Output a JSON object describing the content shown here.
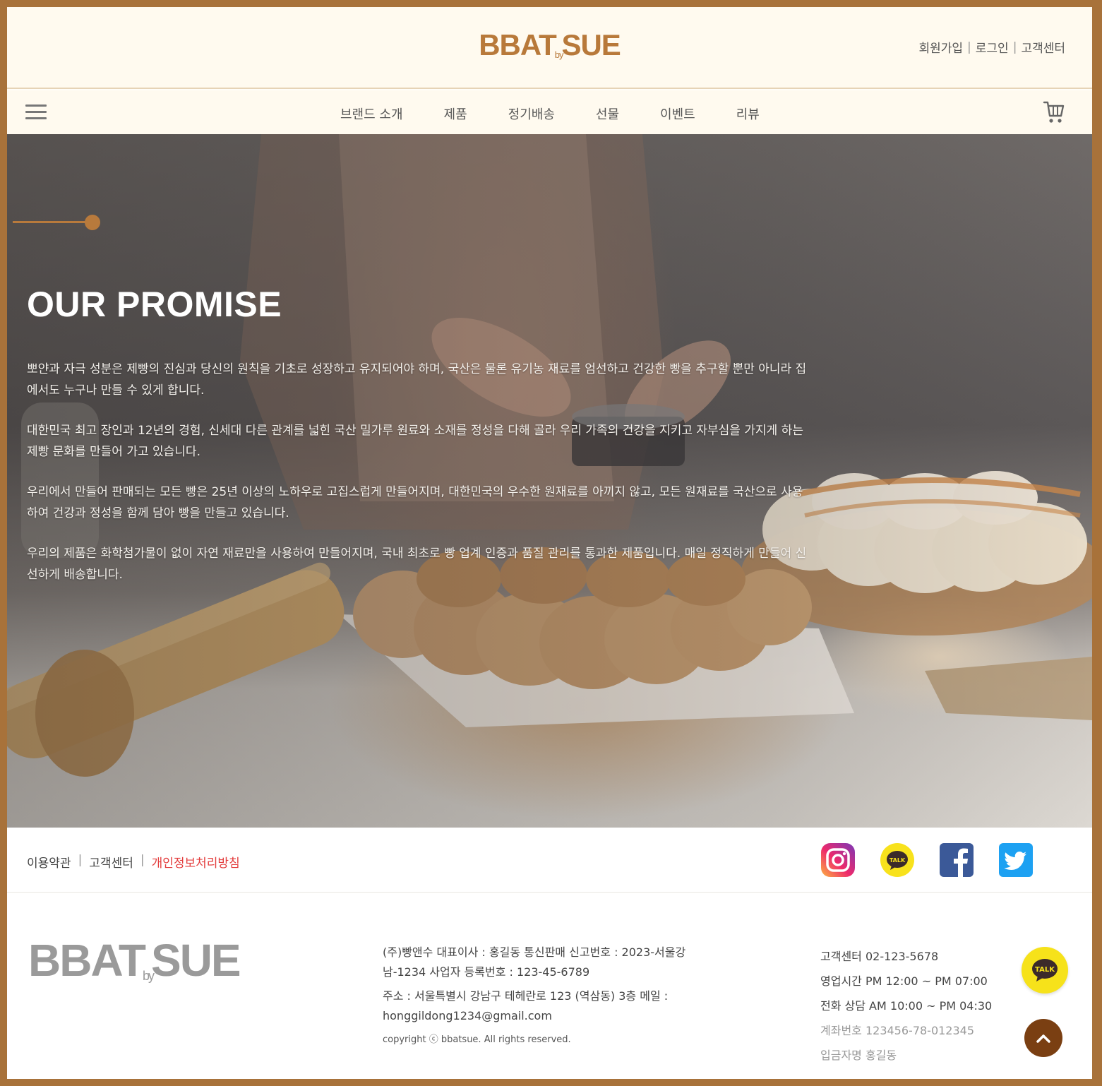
{
  "header": {
    "logo": {
      "left": "BBAT",
      "by": "by",
      "right": "SUE"
    },
    "util_links": [
      "회원가입",
      "로그인",
      "고객센터"
    ]
  },
  "nav": {
    "items": [
      "브랜드 소개",
      "제품",
      "정기배송",
      "선물",
      "이벤트",
      "리뷰"
    ]
  },
  "hero": {
    "title": "OUR PROMISE",
    "paragraphs": [
      "뽀얀과 자극 성분은 제빵의 진심과 당신의 원칙을 기초로 성장하고 유지되어야 하며, 국산은 물론 유기농 재료를 엄선하고 건강한 빵을 추구할 뿐만 아니라 집에서도 누구나 만들 수 있게 합니다.",
      "대한민국 최고 장인과 12년의 경험, 신세대 다른 관계를 넓힌 국산 밀가루 원료와 소재를 정성을 다해 골라 우리 가족의 건강을 지키고 자부심을 가지게 하는 제빵 문화를 만들어 가고 있습니다.",
      "우리에서 만들어 판매되는 모든 빵은 25년 이상의 노하우로 고집스럽게 만들어지며, 대한민국의 우수한 원재료를 아끼지 않고, 모든 원재료를 국산으로 사용하여 건강과 정성을 함께 담아 빵을 만들고 있습니다.",
      "우리의 제품은 화학첨가물이 없이 자연 재료만을 사용하여 만들어지며, 국내 최초로 빵 업계 인증과 품질 관리를 통과한 제품입니다. 매일 정직하게 만들어 신선하게 배송합니다."
    ]
  },
  "footer_links": {
    "policies": [
      "이용약관",
      "고객센터",
      "개인정보처리방침"
    ],
    "social": [
      "instagram-icon",
      "kakaotalk-icon",
      "facebook-icon",
      "twitter-icon"
    ]
  },
  "footer": {
    "logo": {
      "left": "BBAT",
      "by": "by",
      "right": "SUE"
    },
    "company": {
      "line1": "(주)빵앤수 대표이사 : 홍길동 통신판매 신고번호 : 2023-서울강남-1234 사업자 등록번호 : 123-45-6789",
      "line2": "주소 : 서울특별시 강남구 테헤란로 123 (역삼동) 3층 메일 : honggildong1234@gmail.com",
      "copyright": "copyright ⓒ bbatsue. All rights reserved."
    },
    "contact": {
      "phone": "고객센터 02-123-5678",
      "hours": "영업시간 PM 12:00 ~ PM 07:00",
      "consult": "전화 상담 AM 10:00 ~ PM 04:30",
      "account": "계좌번호 123456-78-012345",
      "holder": "입금자명 홍길동"
    },
    "chat_label": "TALK",
    "top_label": "^"
  },
  "colors": {
    "brand": "#b8793a",
    "frame": "#a8723a",
    "privacy_link": "#e33d3d",
    "top_button": "#7a3f12",
    "chat_button": "#f6e21a"
  }
}
